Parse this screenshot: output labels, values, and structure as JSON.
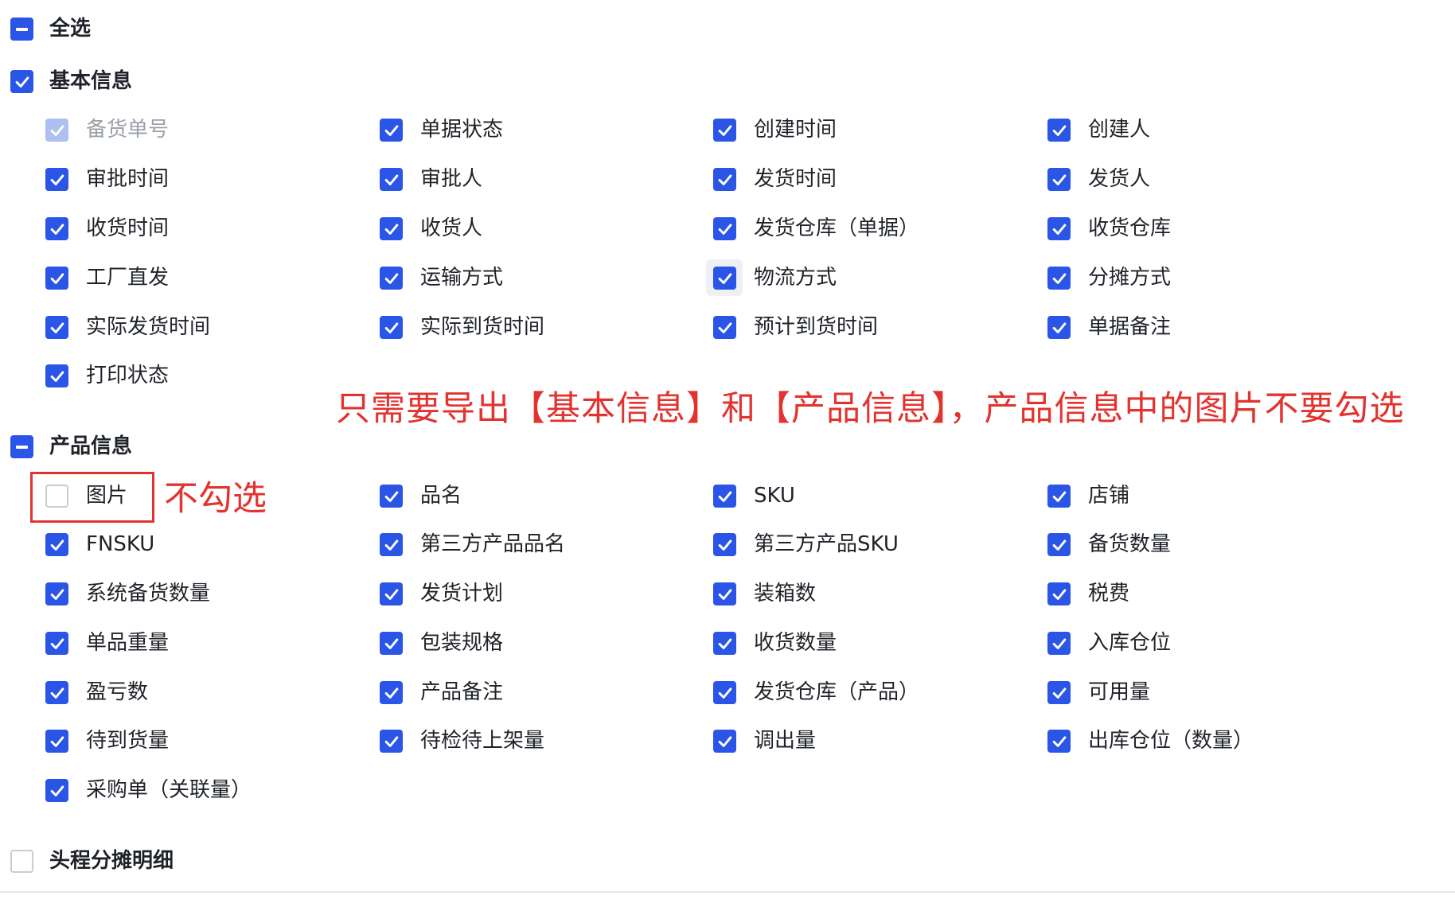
{
  "select_all": {
    "label": "全选",
    "state": "indeterminate"
  },
  "groups": [
    {
      "id": "basic",
      "label": "基本信息",
      "state": "checked",
      "items": [
        {
          "label": "备货单号",
          "checked": true,
          "disabled": true
        },
        {
          "label": "单据状态",
          "checked": true
        },
        {
          "label": "创建时间",
          "checked": true
        },
        {
          "label": "创建人",
          "checked": true
        },
        {
          "label": "审批时间",
          "checked": true
        },
        {
          "label": "审批人",
          "checked": true
        },
        {
          "label": "发货时间",
          "checked": true
        },
        {
          "label": "发货人",
          "checked": true
        },
        {
          "label": "收货时间",
          "checked": true
        },
        {
          "label": "收货人",
          "checked": true
        },
        {
          "label": "发货仓库（单据）",
          "checked": true
        },
        {
          "label": "收货仓库",
          "checked": true
        },
        {
          "label": "工厂直发",
          "checked": true
        },
        {
          "label": "运输方式",
          "checked": true
        },
        {
          "label": "物流方式",
          "checked": true,
          "hovered": true
        },
        {
          "label": "分摊方式",
          "checked": true
        },
        {
          "label": "实际发货时间",
          "checked": true
        },
        {
          "label": "实际到货时间",
          "checked": true
        },
        {
          "label": "预计到货时间",
          "checked": true
        },
        {
          "label": "单据备注",
          "checked": true
        },
        {
          "label": "打印状态",
          "checked": true
        }
      ]
    },
    {
      "id": "product",
      "label": "产品信息",
      "state": "indeterminate",
      "items": [
        {
          "label": "图片",
          "checked": false
        },
        {
          "label": "品名",
          "checked": true
        },
        {
          "label": "SKU",
          "checked": true
        },
        {
          "label": "店铺",
          "checked": true
        },
        {
          "label": "FNSKU",
          "checked": true
        },
        {
          "label": "第三方产品品名",
          "checked": true
        },
        {
          "label": "第三方产品SKU",
          "checked": true
        },
        {
          "label": "备货数量",
          "checked": true
        },
        {
          "label": "系统备货数量",
          "checked": true
        },
        {
          "label": "发货计划",
          "checked": true
        },
        {
          "label": "装箱数",
          "checked": true
        },
        {
          "label": "税费",
          "checked": true
        },
        {
          "label": "单品重量",
          "checked": true
        },
        {
          "label": "包装规格",
          "checked": true
        },
        {
          "label": "收货数量",
          "checked": true
        },
        {
          "label": "入库仓位",
          "checked": true
        },
        {
          "label": "盈亏数",
          "checked": true
        },
        {
          "label": "产品备注",
          "checked": true
        },
        {
          "label": "发货仓库（产品）",
          "checked": true
        },
        {
          "label": "可用量",
          "checked": true
        },
        {
          "label": "待到货量",
          "checked": true
        },
        {
          "label": "待检待上架量",
          "checked": true
        },
        {
          "label": "调出量",
          "checked": true
        },
        {
          "label": "出库仓位（数量）",
          "checked": true
        },
        {
          "label": "采购单（关联量）",
          "checked": true
        }
      ]
    },
    {
      "id": "headhaul",
      "label": "头程分摊明细",
      "state": "unchecked",
      "items": []
    }
  ],
  "annotations": {
    "main": "只需要导出【基本信息】和【产品信息】，产品信息中的图片不要勾选",
    "side": "不勾选"
  },
  "colors": {
    "checkbox_checked": "#2b55e6",
    "checkbox_disabled": "#aebff2",
    "checkbox_border": "#c9cdd4",
    "annotation_red": "#e2332f",
    "text": "#1f2329",
    "text_disabled": "#9aa0a8"
  },
  "icons": {
    "checkmark": "checkmark-icon",
    "indeterminate": "minus-icon"
  }
}
